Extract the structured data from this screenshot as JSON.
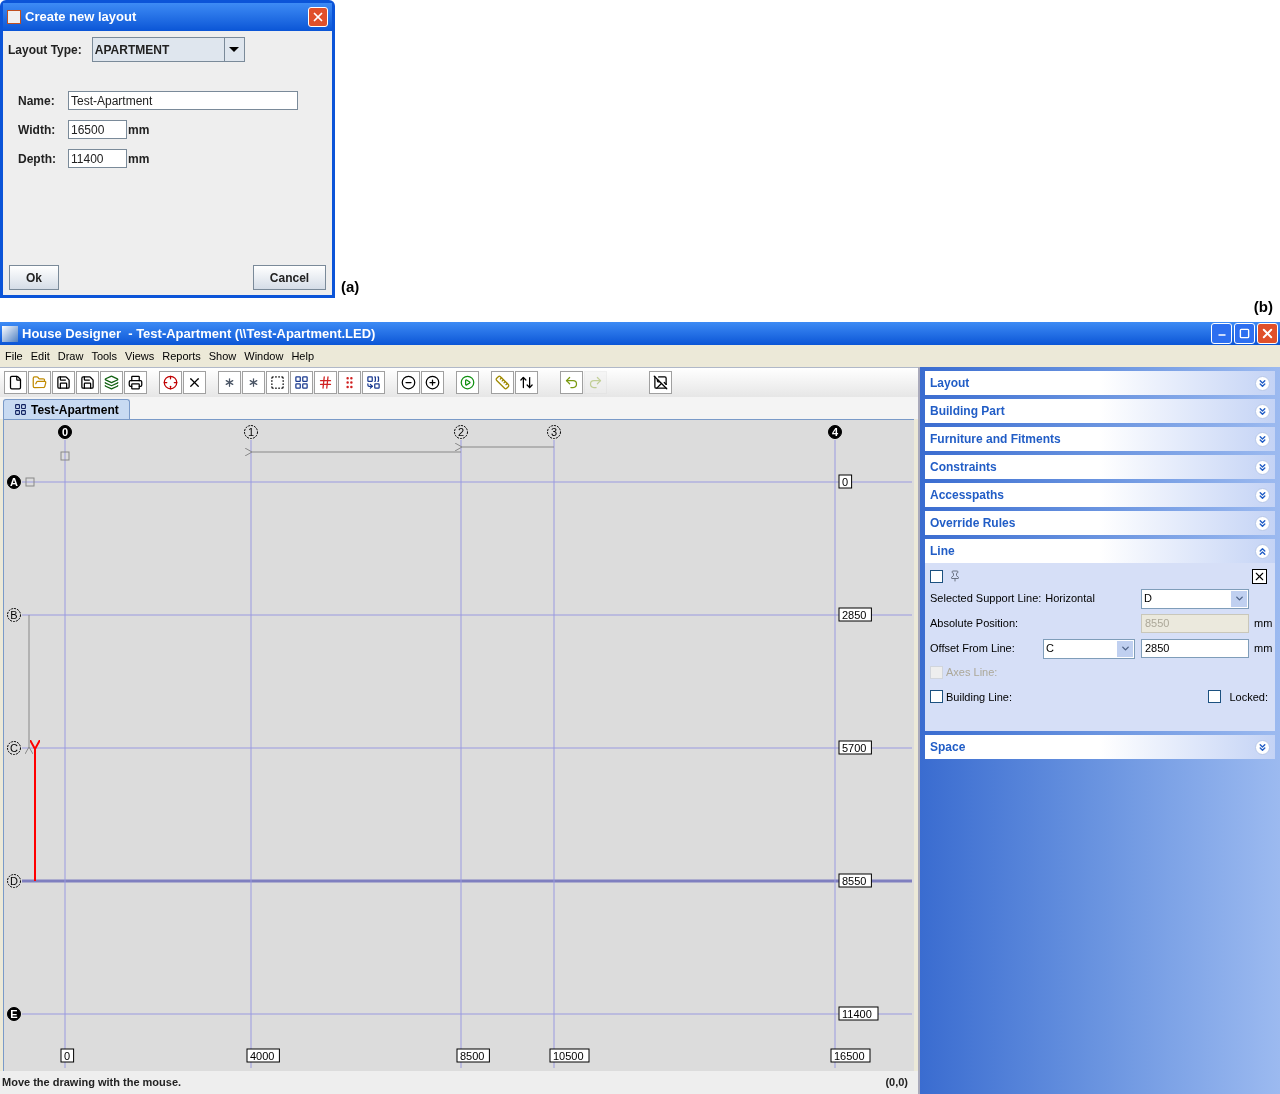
{
  "dialog": {
    "title": "Create new layout",
    "layout_type_label": "Layout Type:",
    "layout_type": "APARTMENT",
    "fields": [
      {
        "label": "Name:",
        "value": "Test-Apartment"
      },
      {
        "label": "Width:",
        "value": "16500",
        "unit": "mm"
      },
      {
        "label": "Depth:",
        "value": "11400",
        "unit": "mm"
      }
    ],
    "buttons": [
      "Ok",
      "Cancel"
    ]
  },
  "caption_a": "(a)",
  "caption_b": "(b)",
  "window": {
    "title": "House Designer  - Test-Apartment (\\\\Test-Apartment.LED)"
  },
  "menu": [
    "File",
    "Edit",
    "Draw",
    "Tools",
    "Views",
    "Reports",
    "Show",
    "Window",
    "Help"
  ],
  "toolbar": [
    [
      {
        "disabled": false
      },
      {
        "disabled": false
      },
      {
        "disabled": false
      },
      {
        "disabled": false
      },
      {
        "disabled": false
      },
      {
        "disabled": false
      }
    ],
    [
      {
        "disabled": false
      },
      {
        "disabled": false
      }
    ],
    [
      {
        "disabled": false
      },
      {
        "disabled": false
      },
      {
        "disabled": false
      },
      {
        "disabled": false
      },
      {
        "disabled": false
      },
      {
        "disabled": false
      },
      {
        "disabled": false
      }
    ],
    [
      {
        "disabled": false
      },
      {
        "disabled": false
      }
    ],
    [
      {
        "disabled": false
      }
    ],
    [
      {
        "disabled": false
      },
      {
        "disabled": false
      }
    ],
    [
      {
        "disabled": false
      },
      {
        "disabled": true
      }
    ],
    [
      {
        "disabled": false
      }
    ]
  ],
  "tabs": [
    {
      "label": "Test-Apartment",
      "selected": true
    }
  ],
  "grid": {
    "columns": [
      {
        "label": "0",
        "filled": true,
        "dimension": "0"
      },
      {
        "label": "1",
        "filled": false,
        "dimension": "4000"
      },
      {
        "label": "2",
        "filled": false,
        "dimension": "8500"
      },
      {
        "label": "3",
        "filled": false,
        "dimension": "10500"
      },
      {
        "label": "4",
        "filled": true,
        "dimension": "16500"
      }
    ],
    "rows": [
      {
        "label": "A",
        "filled": true,
        "dimension": "0",
        "selected": false
      },
      {
        "label": "B",
        "filled": false,
        "dimension": "2850",
        "selected": false
      },
      {
        "label": "C",
        "filled": false,
        "dimension": "5700",
        "selected": false
      },
      {
        "label": "D",
        "filled": false,
        "dimension": "8550",
        "selected": true
      },
      {
        "label": "E",
        "filled": true,
        "dimension": "11400",
        "selected": false
      }
    ]
  },
  "status_bar": {
    "message": "Move the drawing with the mouse.",
    "coordinates": "(0,0)"
  },
  "panel": {
    "sections": [
      {
        "title": "Layout",
        "expanded": false
      },
      {
        "title": "Building Part",
        "expanded": false
      },
      {
        "title": "Furniture and Fitments",
        "expanded": false
      },
      {
        "title": "Constraints",
        "expanded": false
      },
      {
        "title": "Accesspaths",
        "expanded": false
      },
      {
        "title": "Override Rules",
        "expanded": false
      },
      {
        "title": "Line",
        "expanded": true
      },
      {
        "title": "Space",
        "expanded": false
      }
    ],
    "line": {
      "pinned": false,
      "support_line": {
        "label": "Selected Support Line:",
        "orientation": "Horizontal",
        "value": "D"
      },
      "absolute_position": {
        "label": "Absolute Position:",
        "value": "8550",
        "unit": "mm",
        "disabled": true
      },
      "offset": {
        "label": "Offset From Line:",
        "line": "C",
        "value": "2850",
        "unit": "mm"
      },
      "checkboxes": [
        {
          "label": "Axes Line:",
          "checked": false,
          "disabled": true
        },
        {
          "label": "Building Line:",
          "checked": false,
          "disabled": false
        },
        {
          "label": "Locked:",
          "checked": false,
          "disabled": false
        }
      ]
    }
  }
}
